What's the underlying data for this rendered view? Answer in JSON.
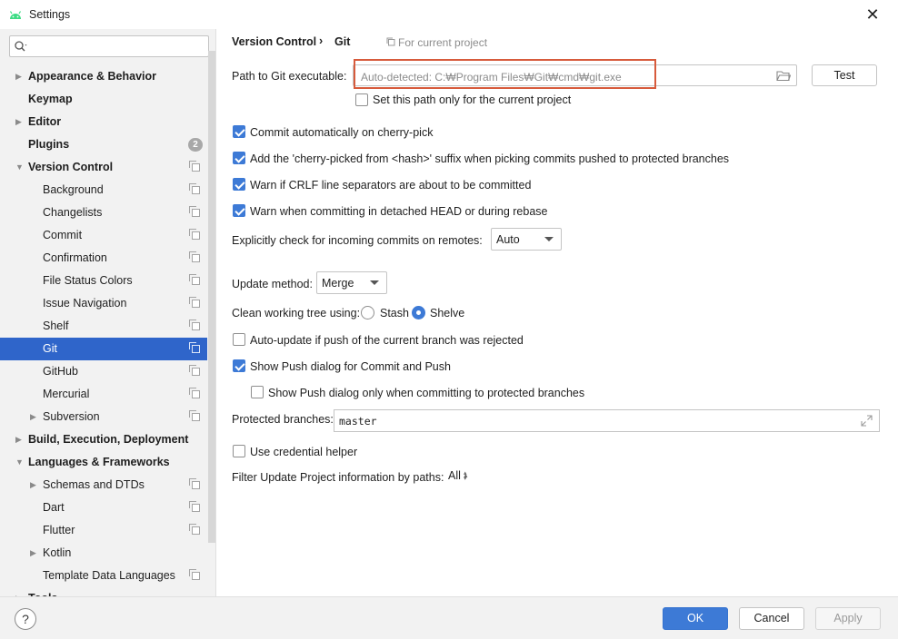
{
  "window": {
    "title": "Settings",
    "close_glyph": "✕"
  },
  "search": {
    "placeholder": "",
    "value": ""
  },
  "sidebar": {
    "items": [
      {
        "label": "Appearance & Behavior",
        "bold": true,
        "arrow": "right",
        "indent": 0
      },
      {
        "label": "Keymap",
        "bold": true,
        "arrow": "",
        "indent": 0
      },
      {
        "label": "Editor",
        "bold": true,
        "arrow": "right",
        "indent": 0
      },
      {
        "label": "Plugins",
        "bold": true,
        "arrow": "",
        "indent": 0,
        "badge": "2"
      },
      {
        "label": "Version Control",
        "bold": true,
        "arrow": "down",
        "indent": 0,
        "copy": true
      },
      {
        "label": "Background",
        "indent": 1,
        "copy": true
      },
      {
        "label": "Changelists",
        "indent": 1,
        "copy": true
      },
      {
        "label": "Commit",
        "indent": 1,
        "copy": true
      },
      {
        "label": "Confirmation",
        "indent": 1,
        "copy": true
      },
      {
        "label": "File Status Colors",
        "indent": 1,
        "copy": true
      },
      {
        "label": "Issue Navigation",
        "indent": 1,
        "copy": true
      },
      {
        "label": "Shelf",
        "indent": 1,
        "copy": true
      },
      {
        "label": "Git",
        "indent": 1,
        "copy": true,
        "selected": true
      },
      {
        "label": "GitHub",
        "indent": 1,
        "copy": true
      },
      {
        "label": "Mercurial",
        "indent": 1,
        "copy": true
      },
      {
        "label": "Subversion",
        "indent": 1,
        "arrow": "right",
        "copy": true
      },
      {
        "label": "Build, Execution, Deployment",
        "bold": true,
        "arrow": "right",
        "indent": 0
      },
      {
        "label": "Languages & Frameworks",
        "bold": true,
        "arrow": "down",
        "indent": 0
      },
      {
        "label": "Schemas and DTDs",
        "indent": 1,
        "arrow": "right",
        "copy": true
      },
      {
        "label": "Dart",
        "indent": 1,
        "copy": true
      },
      {
        "label": "Flutter",
        "indent": 1,
        "copy": true
      },
      {
        "label": "Kotlin",
        "indent": 1,
        "arrow": "right"
      },
      {
        "label": "Template Data Languages",
        "indent": 1,
        "copy": true
      },
      {
        "label": "Tools",
        "bold": true,
        "arrow": "right",
        "indent": 0
      }
    ]
  },
  "breadcrumb": {
    "parent": "Version Control",
    "separator": "›",
    "current": "Git",
    "for_project": "For current project"
  },
  "git": {
    "path_label": "Path to Git executable:",
    "path_placeholder": "Auto-detected: C:₩Program Files₩Git₩cmd₩git.exe",
    "test_button": "Test",
    "path_only_project": {
      "label": "Set this path only for the current project",
      "checked": false
    },
    "commit_cherry_pick": {
      "label": "Commit automatically on cherry-pick",
      "checked": true
    },
    "cherry_pick_suffix": {
      "label": "Add the 'cherry-picked from <hash>' suffix when picking commits pushed to protected branches",
      "checked": true
    },
    "warn_crlf": {
      "label": "Warn if CRLF line separators are about to be committed",
      "checked": true
    },
    "warn_detached": {
      "label": "Warn when committing in detached HEAD or during rebase",
      "checked": true
    },
    "incoming_label": "Explicitly check for incoming commits on remotes:",
    "incoming_value": "Auto",
    "update_method_label": "Update method:",
    "update_method_value": "Merge",
    "clean_tree_label": "Clean working tree using:",
    "stash_label": "Stash",
    "shelve_label": "Shelve",
    "clean_tree_selected": "Shelve",
    "auto_update": {
      "label": "Auto-update if push of the current branch was rejected",
      "checked": false
    },
    "show_push": {
      "label": "Show Push dialog for Commit and Push",
      "checked": true
    },
    "show_push_protected": {
      "label": "Show Push dialog only when committing to protected branches",
      "checked": false
    },
    "protected_label": "Protected branches:",
    "protected_value": "master",
    "credential_helper": {
      "label": "Use credential helper",
      "checked": false
    },
    "filter_label": "Filter Update Project information by paths:",
    "filter_value": "All"
  },
  "footer": {
    "help": "?",
    "ok": "OK",
    "cancel": "Cancel",
    "apply": "Apply"
  },
  "colors": {
    "accent": "#3d7ad6",
    "selection": "#2f65ca",
    "highlight_box": "#d75b3c",
    "sidebar_bg": "#f2f2f2"
  }
}
